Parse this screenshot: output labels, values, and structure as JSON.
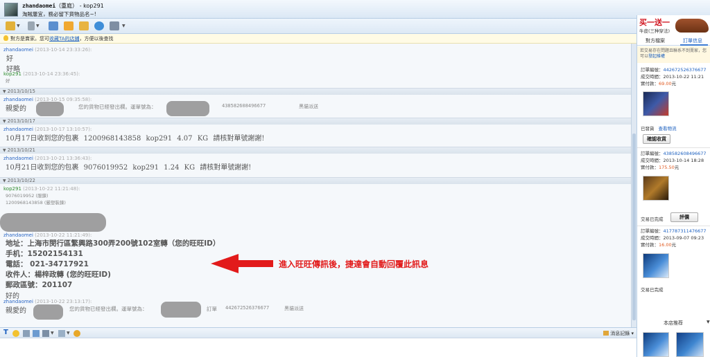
{
  "window": {
    "user": "zhandaomei",
    "user_suffix": "（重庭）",
    "sep": " - ",
    "peer": "kop291",
    "signature": "淘賊屢宜，務必留下貨物品名~!"
  },
  "notice": {
    "prefix": "對方是賣家。您可",
    "link": "收藏TA的店鋪",
    "suffix": "，方便以後查找"
  },
  "messages": {
    "m1": {
      "sender": "zhandaomei",
      "time": "(2013-10-14 23:33:26):",
      "line1": "好",
      "line2": "好略"
    },
    "m2": {
      "sender": "kop291",
      "time": "(2013-10-14 23:36:45):",
      "line1": "好"
    },
    "d1": "2013/10/15",
    "m3": {
      "sender": "zhandaomei",
      "time": "(2013-10-15 09:35:58):",
      "lead": "親愛的",
      "mid": "您的貨物已經發出欄。運單號為：",
      "num": "438582608496677",
      "tail": "黑貓派送"
    },
    "d2": "2013/10/17",
    "m4": {
      "sender": "zhandaomei",
      "time": "(2013-10-17 13:10:57):",
      "text": "10月17日收到您的包裹  1200968143858    kop291    4.07    KG    請核對單號謝謝!"
    },
    "d3": "2013/10/21",
    "m5": {
      "sender": "zhandaomei",
      "time": "(2013-10-21 13:36:43):",
      "text": "10月21日收到您的包裹  9076019952    kop291    1.24    KG    請核對單號謝謝!"
    },
    "d4": "2013/10/22",
    "m6": {
      "sender": "kop291",
      "time": "(2013-10-22 11:21:48):",
      "line1": "9076019952 (服鍊)",
      "line2": "1200968143858 (嚴塑裝鍊)"
    },
    "m7": {
      "sender": "zhandaomei",
      "time": "(2013-10-22 11:21:49):",
      "addr": "地址：上海市閔行區繁興路300弄200號102室轉（您的旺旺ID）",
      "phone": "手机：15202154131",
      "tel": "電話： 021-34717921",
      "recv": "收件人：楊梓政轉    (您的旺旺ID)",
      "zip": "郵政區號：201107",
      "ok": "好的"
    },
    "m8": {
      "sender": "zhandaomei",
      "time": "(2013-10-22 23:13:17):",
      "lead": "親愛的",
      "mid": "您的貨物已經發出欄。運單號為：",
      "order": "訂單",
      "num": "442672526376677",
      "tail": "黑貓派送"
    }
  },
  "annotation": "進入旺旺傳訊後，捷達會自動回覆此訊息",
  "input_bar": {
    "msg_record": "消息記錄"
  },
  "right_panel": {
    "ad_big": "买一送一",
    "ad_sub": "牛皮(三种穿法)",
    "tab_shop": "對方檔案",
    "tab_order": "訂單信息",
    "hint_text": "若交易存在問題且聯系不到賣家，您可以",
    "hint_link": "發起維權",
    "orders": [
      {
        "no_label": "訂單編號：",
        "no": "442672526376677",
        "time_label": "成交時間：",
        "time": "2013-10-22 11:21",
        "pay_label": "實付款：",
        "pay": "69.00",
        "unit": "元",
        "status": "已發貨",
        "link": "查看物流",
        "button": "確認收貨"
      },
      {
        "no_label": "訂單編號：",
        "no": "438582608496677",
        "time_label": "成交時間：",
        "time": "2013-10-14 18:28",
        "pay_label": "實付款：",
        "pay": "175.50",
        "unit": "元",
        "status": "交易已完成",
        "button": "評價"
      },
      {
        "no_label": "訂單編號：",
        "no": "417787311476677",
        "time_label": "成交時間：",
        "time": "2013-09-07 09:23",
        "pay_label": "實付款：",
        "pay": "16.00",
        "unit": "元",
        "status": "交易已完成"
      }
    ],
    "shop_rec": "本店推荐"
  },
  "colors": {
    "accent": "#1b5fbf",
    "annotation": "#e21b1b",
    "price": "#e0561b"
  }
}
